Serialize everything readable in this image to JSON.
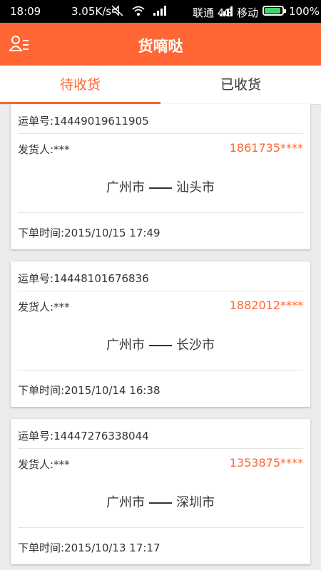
{
  "status_bar": {
    "time": "18:09",
    "speed": "3.05K/s",
    "carrier1": "联通 4G",
    "carrier2": "移动",
    "battery": "100%"
  },
  "header": {
    "title": "货嘀哒",
    "menu_icon": "user-list-icon"
  },
  "tabs": [
    {
      "label": "待收货",
      "active": true
    },
    {
      "label": "已收货",
      "active": false
    }
  ],
  "orders": [
    {
      "waybill_label": "运单号:",
      "waybill": "14449019611905",
      "sender_label": "发货人:",
      "sender": "***",
      "phone": "1861735****",
      "from": "广州市",
      "to": "汕头市",
      "time_label": "下单时间:",
      "time": "2015/10/15 17:49"
    },
    {
      "waybill_label": "运单号:",
      "waybill": "14448101676836",
      "sender_label": "发货人:",
      "sender": "***",
      "phone": "1882012****",
      "from": "广州市",
      "to": "长沙市",
      "time_label": "下单时间:",
      "time": "2015/10/14 16:38"
    },
    {
      "waybill_label": "运单号:",
      "waybill": "14447276338044",
      "sender_label": "发货人:",
      "sender": "***",
      "phone": "1353875****",
      "from": "广州市",
      "to": "深圳市",
      "time_label": "下单时间:",
      "time": "2015/10/13 17:17"
    }
  ],
  "colors": {
    "accent": "#ff6633",
    "status_bar": "#000000",
    "background": "#ececec"
  }
}
